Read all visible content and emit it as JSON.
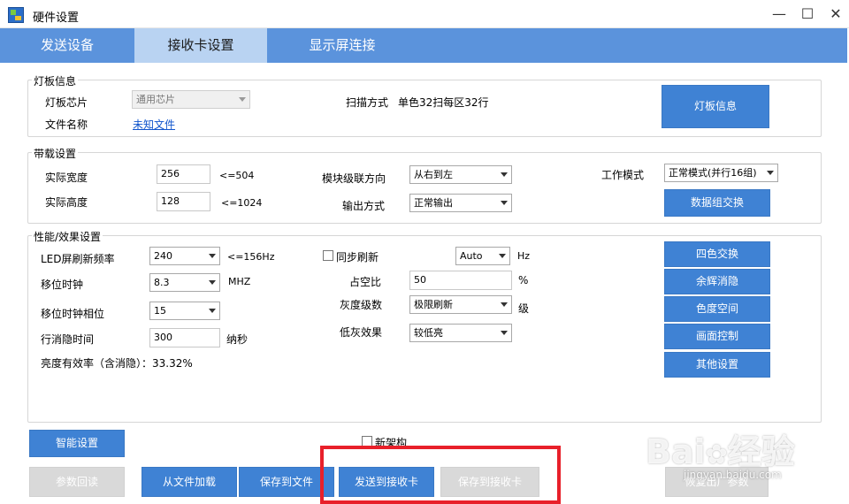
{
  "window": {
    "title": "硬件设置",
    "minimize": "—",
    "maximize": "☐",
    "close": "✕"
  },
  "tabs": [
    {
      "label": "发送设备"
    },
    {
      "label": "接收卡设置"
    },
    {
      "label": "显示屏连接"
    }
  ],
  "panel_info": {
    "title": "灯板信息",
    "chip_label": "灯板芯片",
    "chip_value": "通用芯片",
    "file_label": "文件名称",
    "file_link": "未知文件",
    "scan_label": "扫描方式",
    "scan_value": "单色32扫每区32行",
    "info_button": "灯板信息"
  },
  "panel_load": {
    "title": "带载设置",
    "width_label": "实际宽度",
    "width_value": "256",
    "width_limit": "<=504",
    "height_label": "实际高度",
    "height_value": "128",
    "height_limit": "<=1024",
    "cascade_label": "模块级联方向",
    "cascade_value": "从右到左",
    "output_label": "输出方式",
    "output_value": "正常输出",
    "mode_label": "工作模式",
    "mode_value": "正常模式(并行16组)",
    "swap_button": "数据组交换"
  },
  "panel_perf": {
    "title": "性能/效果设置",
    "refresh_label": "LED屏刷新频率",
    "refresh_value": "240",
    "refresh_limit": "<=156Hz",
    "shift_label": "移位时钟",
    "shift_value": "8.3",
    "shift_unit": "MHZ",
    "phase_label": "移位时钟相位",
    "phase_value": "15",
    "blank_label": "行消隐时间",
    "blank_value": "300",
    "blank_unit": "纳秒",
    "efficiency_text": "亮度有效率（含消隐）：33.32%",
    "sync_label": "同步刷新",
    "sync_value": "Auto",
    "sync_unit": "Hz",
    "duty_label": "占空比",
    "duty_value": "50",
    "duty_unit": "%",
    "gray_label": "灰度级数",
    "gray_value": "极限刷新",
    "gray_unit": "级",
    "lowgray_label": "低灰效果",
    "lowgray_value": "较低亮",
    "side_buttons": [
      "四色交换",
      "余辉消隐",
      "色度空间",
      "画面控制",
      "其他设置"
    ]
  },
  "bottom": {
    "smart_button": "智能设置",
    "new_arch_label": "新架构",
    "readback_button": "参数回读",
    "load_file_button": "从文件加载",
    "save_file_button": "保存到文件",
    "send_button": "发送到接收卡",
    "save_card_button": "保存到接收卡",
    "restore_button": "恢复出厂参数"
  },
  "watermark": {
    "brand": "Bai",
    "brand2": "经验",
    "url": "jingyan.baidu.com"
  },
  "colors": {
    "tab_bar": "#5b93dc",
    "tab_active": "#b9d3f2",
    "button": "#3f82d4",
    "highlight_box": "#e8202a"
  }
}
